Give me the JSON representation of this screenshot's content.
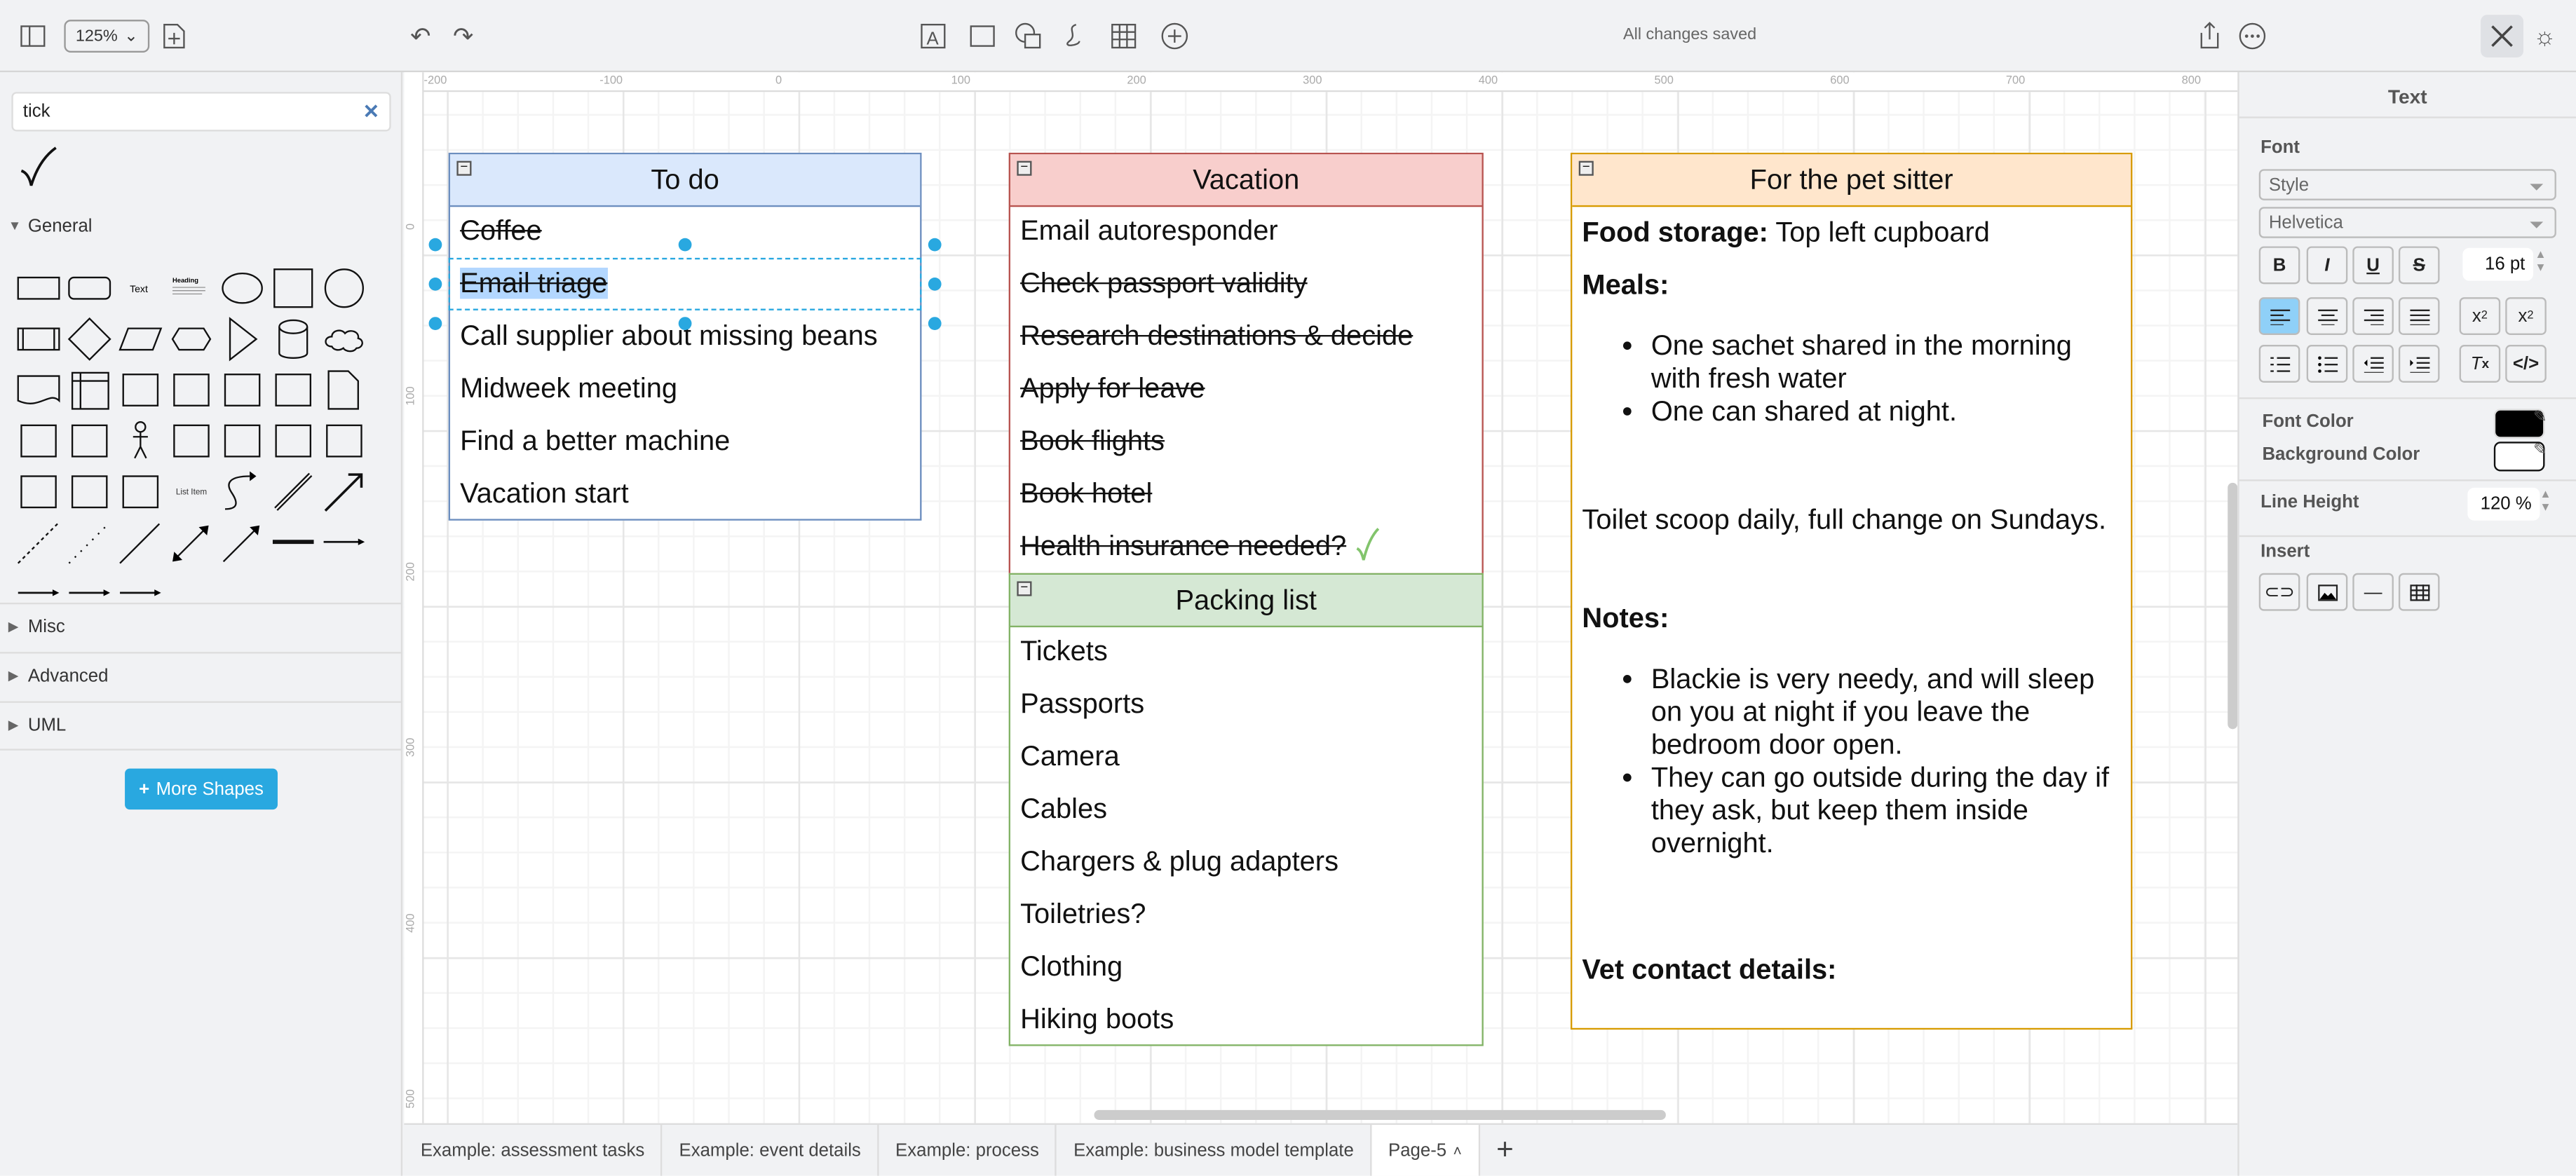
{
  "toolbar": {
    "zoom": "125%",
    "status": "All changes saved",
    "icons": [
      "sidebar-toggle-icon",
      "new-page-icon",
      "undo-icon",
      "redo-icon",
      "text-icon",
      "rectangle-icon",
      "shapes-icon",
      "freehand-icon",
      "table-icon",
      "insert-icon",
      "share-icon",
      "more-icon",
      "format-icon",
      "theme-icon"
    ]
  },
  "sidebar": {
    "search_value": "tick",
    "search_result": "checkmark-shape",
    "sections": [
      {
        "label": "General",
        "expanded": true
      },
      {
        "label": "Misc"
      },
      {
        "label": "Advanced"
      },
      {
        "label": "UML"
      }
    ],
    "shape_text": "Text",
    "shape_heading": "Heading",
    "shape_list_item": "List Item",
    "more_shapes": "More Shapes",
    "shapes": [
      "rectangle",
      "rounded-rectangle",
      "text",
      "heading",
      "ellipse",
      "square",
      "circle",
      "process",
      "diamond",
      "parallelogram",
      "hexagon",
      "triangle",
      "cylinder",
      "cloud",
      "document",
      "internal-storage",
      "cube",
      "step",
      "trapezoid",
      "tape",
      "note",
      "card",
      "callout",
      "actor",
      "or",
      "data-storage",
      "sequential-data",
      "square2",
      "container",
      "swimlane",
      "list",
      "list-item",
      "curve",
      "bidirectional-arrow",
      "arrow",
      "dashed-line",
      "dotted-line",
      "line",
      "bidirectional-connector",
      "directional-connector",
      "link",
      "connector-label",
      "connector-source-label",
      "connector-source-target",
      "connector-symbol"
    ]
  },
  "ruler": {
    "top": [
      "-200",
      "-100",
      "0",
      "100",
      "200",
      "300",
      "400",
      "500",
      "600",
      "700",
      "800"
    ],
    "left": [
      "0",
      "100",
      "200",
      "300",
      "400",
      "500"
    ]
  },
  "canvas": {
    "todo": {
      "title": "To do",
      "color": "#dae8fc",
      "border": "#6c8ebf",
      "items": [
        {
          "text": "Coffee",
          "done": true
        },
        {
          "text": "Email triage",
          "done": true,
          "selected": true
        },
        {
          "text": "Call supplier about missing beans",
          "done": false
        },
        {
          "text": "Midweek meeting",
          "done": false
        },
        {
          "text": "Find a better machine",
          "done": false
        },
        {
          "text": "Vacation start",
          "done": false
        }
      ]
    },
    "vacation": {
      "title": "Vacation",
      "color": "#f8cecc",
      "border": "#b85450",
      "items": [
        {
          "text": "Email autoresponder",
          "done": false
        },
        {
          "text": "Check passport validity",
          "done": true
        },
        {
          "text": "Research destinations & decide",
          "done": true
        },
        {
          "text": "Apply for leave",
          "done": true
        },
        {
          "text": "Book flights",
          "done": true
        },
        {
          "text": "Book hotel",
          "done": true
        },
        {
          "text": "Health insurance needed?",
          "done": true
        }
      ]
    },
    "packing": {
      "title": "Packing list",
      "color": "#d5e8d4",
      "border": "#82b366",
      "items": [
        "Tickets",
        "Passports",
        "Camera",
        "Cables",
        "Chargers & plug adapters",
        "Toiletries?",
        "Clothing",
        "Hiking boots"
      ]
    },
    "pet": {
      "title": "For the pet sitter",
      "color": "#ffe6cc",
      "border": "#d79b00",
      "food_label": "Food storage:",
      "food_value": " Top left cupboard",
      "meals_label": "Meals:",
      "meals": [
        "One sachet shared in the morning with fresh water",
        "One can shared at night."
      ],
      "toilet": "Toilet scoop daily, full change on Sundays.",
      "notes_label": "Notes:",
      "notes": [
        "Blackie is very needy, and will sleep on you at night if you leave the bedroom door open.",
        "They can go outside during the day if they ask, but keep them inside overnight."
      ],
      "vet_label": "Vet contact details:"
    }
  },
  "pages": [
    {
      "label": "Example: assessment tasks"
    },
    {
      "label": "Example: event details"
    },
    {
      "label": "Example: process"
    },
    {
      "label": "Example: business model template"
    },
    {
      "label": "Page-5",
      "active": true
    }
  ],
  "format": {
    "title": "Text",
    "font_label": "Font",
    "style_placeholder": "Style",
    "font_family": "Helvetica",
    "font_size": "16 pt",
    "font_color_label": "Font Color",
    "font_color": "#000000",
    "bg_color_label": "Background Color",
    "bg_color": "#ffffff",
    "line_height_label": "Line Height",
    "line_height": "120 %",
    "insert_label": "Insert",
    "active_align": "left"
  }
}
